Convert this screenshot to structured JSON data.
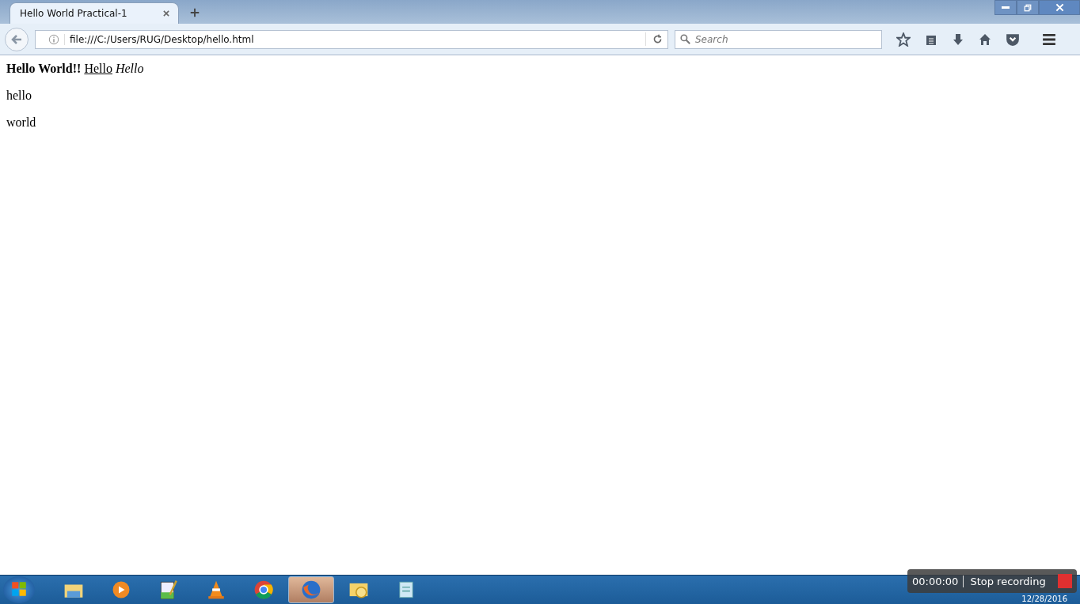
{
  "tabs": [
    {
      "label": "Hello World Practical-1",
      "selected": true
    }
  ],
  "address_bar": {
    "value": "file:///C:/Users/RUG/Desktop/hello.html"
  },
  "search": {
    "placeholder": "Search"
  },
  "page": {
    "first_line": [
      {
        "kind": "bold",
        "text": "Hello World!!"
      },
      {
        "kind": "link",
        "text": "Hello"
      },
      {
        "kind": "italic",
        "text": "Hello"
      }
    ],
    "paragraphs": [
      "hello",
      "world"
    ]
  },
  "taskbar": {
    "apps": [
      {
        "kind": "folder",
        "selected": false
      },
      {
        "kind": "player",
        "selected": false
      },
      {
        "kind": "notepadpp",
        "selected": false
      },
      {
        "kind": "cone",
        "selected": false
      },
      {
        "kind": "chrome",
        "selected": false
      },
      {
        "kind": "firefox",
        "selected": true
      },
      {
        "kind": "mail",
        "selected": false
      },
      {
        "kind": "notepad",
        "selected": false
      }
    ],
    "date": "12/28/2016"
  },
  "recorder": {
    "time": "00:00:00",
    "action": "Stop recording"
  }
}
